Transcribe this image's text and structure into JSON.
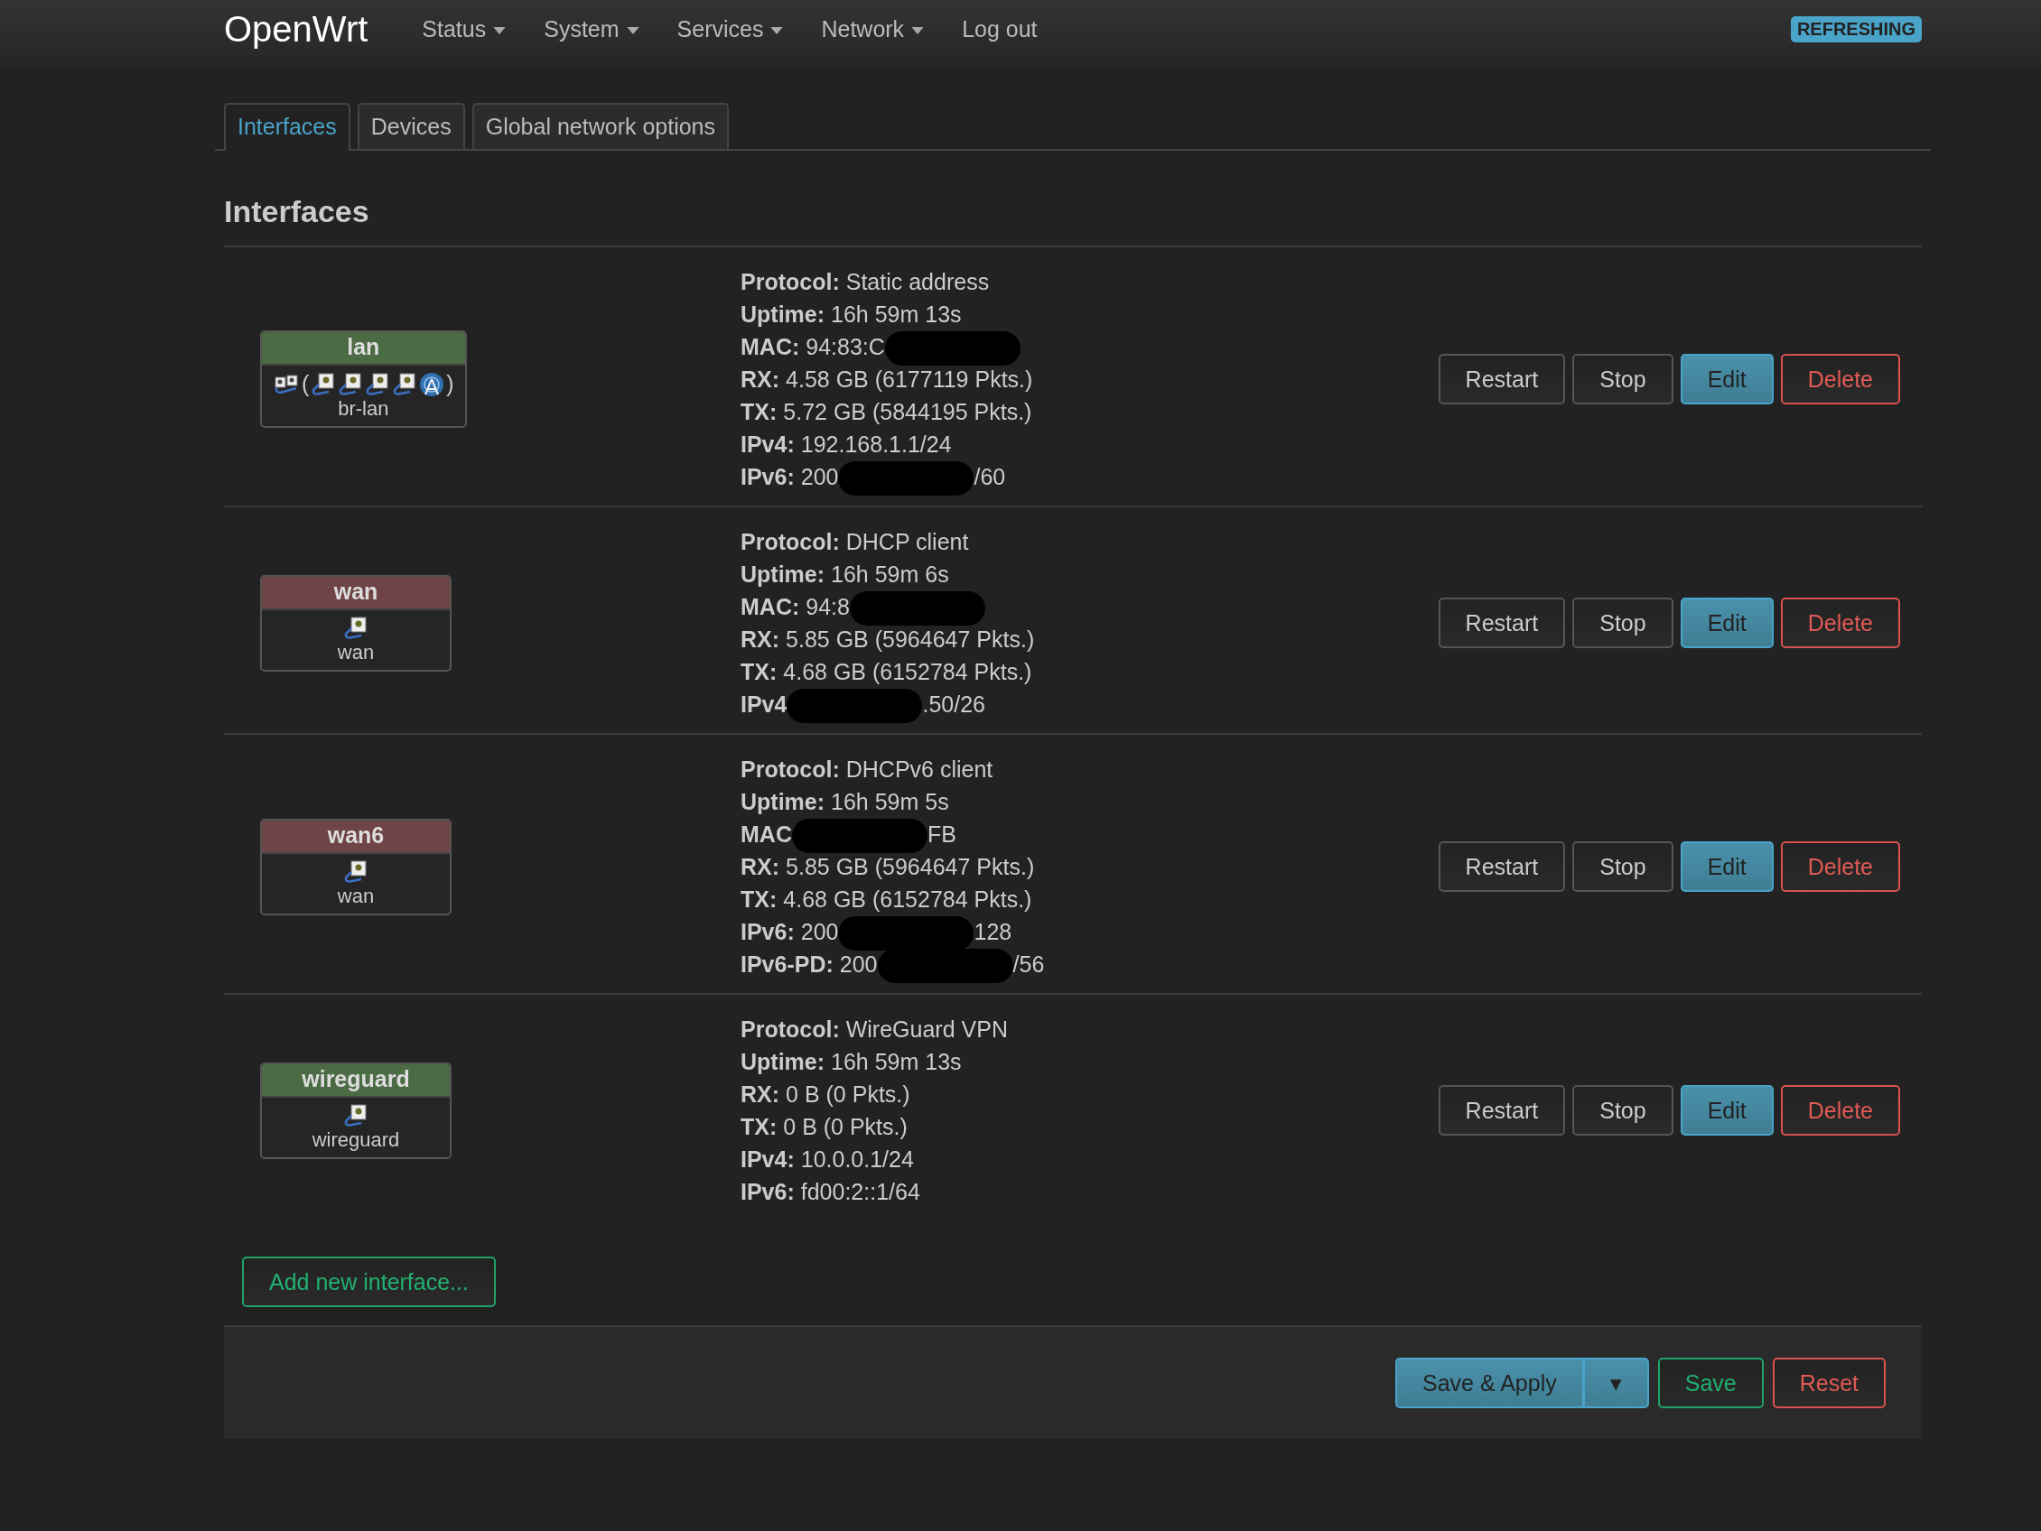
{
  "brand": "OpenWrt",
  "nav": [
    {
      "label": "Status",
      "dropdown": true
    },
    {
      "label": "System",
      "dropdown": true
    },
    {
      "label": "Services",
      "dropdown": true
    },
    {
      "label": "Network",
      "dropdown": true
    },
    {
      "label": "Log out",
      "dropdown": false
    }
  ],
  "indicator": "REFRESHING",
  "tabs": [
    {
      "label": "Interfaces",
      "selected": true
    },
    {
      "label": "Devices",
      "selected": false
    },
    {
      "label": "Global network options",
      "selected": false
    }
  ],
  "heading": "Interfaces",
  "interfaces": [
    {
      "name": "lan",
      "color": "#4a6b44",
      "device": "br-lan",
      "icons": [
        {
          "kind": "bridge"
        },
        {
          "kind": "text",
          "text": "("
        },
        {
          "kind": "ethernet"
        },
        {
          "kind": "ethernet"
        },
        {
          "kind": "ethernet"
        },
        {
          "kind": "ethernet"
        },
        {
          "kind": "wireless"
        },
        {
          "kind": "text",
          "text": ")"
        }
      ],
      "details": [
        {
          "label": "Protocol:",
          "value": "Static address"
        },
        {
          "label": "Uptime:",
          "value": "16h 59m 13s"
        },
        {
          "label": "MAC:",
          "value": "94:83:C",
          "redacted": true
        },
        {
          "label": "RX:",
          "value": "4.58 GB (6177119 Pkts.)"
        },
        {
          "label": "TX:",
          "value": "5.72 GB (5844195 Pkts.)"
        },
        {
          "label": "IPv4:",
          "value": "192.168.1.1/24"
        },
        {
          "label": "IPv6:",
          "value": "200",
          "redacted": true,
          "tail": "/60"
        }
      ],
      "actions": [
        {
          "label": "Restart",
          "kind": "neutral"
        },
        {
          "label": "Stop",
          "kind": "neutral"
        },
        {
          "label": "Edit",
          "kind": "primary"
        },
        {
          "label": "Delete",
          "kind": "danger"
        }
      ]
    },
    {
      "name": "wan",
      "color": "#6e4446",
      "device": "wan",
      "icons": [
        {
          "kind": "ethernet"
        }
      ],
      "details": [
        {
          "label": "Protocol:",
          "value": "DHCP client"
        },
        {
          "label": "Uptime:",
          "value": "16h 59m 6s"
        },
        {
          "label": "MAC:",
          "value": "94:8",
          "redacted": true
        },
        {
          "label": "RX:",
          "value": "5.85 GB (5964647 Pkts.)"
        },
        {
          "label": "TX:",
          "value": "4.68 GB (6152784 Pkts.)"
        },
        {
          "label": "IPv4",
          "redacted": true,
          "tail": ".50/26"
        }
      ],
      "actions": [
        {
          "label": "Restart",
          "kind": "neutral"
        },
        {
          "label": "Stop",
          "kind": "neutral"
        },
        {
          "label": "Edit",
          "kind": "primary"
        },
        {
          "label": "Delete",
          "kind": "danger"
        }
      ]
    },
    {
      "name": "wan6",
      "color": "#6e4446",
      "device": "wan",
      "icons": [
        {
          "kind": "ethernet"
        }
      ],
      "details": [
        {
          "label": "Protocol:",
          "value": "DHCPv6 client"
        },
        {
          "label": "Uptime:",
          "value": "16h 59m 5s"
        },
        {
          "label": "MAC",
          "redacted": true,
          "tail": "FB"
        },
        {
          "label": "RX:",
          "value": "5.85 GB (5964647 Pkts.)"
        },
        {
          "label": "TX:",
          "value": "4.68 GB (6152784 Pkts.)"
        },
        {
          "label": "IPv6:",
          "value": "200",
          "redacted": true,
          "tail": "128"
        },
        {
          "label": "IPv6-PD:",
          "value": "200",
          "redacted": true,
          "tail": "/56"
        }
      ],
      "actions": [
        {
          "label": "Restart",
          "kind": "neutral"
        },
        {
          "label": "Stop",
          "kind": "neutral"
        },
        {
          "label": "Edit",
          "kind": "primary"
        },
        {
          "label": "Delete",
          "kind": "danger"
        }
      ]
    },
    {
      "name": "wireguard",
      "color": "#4a6b44",
      "device": "wireguard",
      "icons": [
        {
          "kind": "ethernet"
        }
      ],
      "details": [
        {
          "label": "Protocol:",
          "value": "WireGuard VPN"
        },
        {
          "label": "Uptime:",
          "value": "16h 59m 13s"
        },
        {
          "label": "RX:",
          "value": "0 B (0 Pkts.)"
        },
        {
          "label": "TX:",
          "value": "0 B (0 Pkts.)"
        },
        {
          "label": "IPv4:",
          "value": "10.0.0.1/24"
        },
        {
          "label": "IPv6:",
          "value": "fd00:2::1/64"
        }
      ],
      "actions": [
        {
          "label": "Restart",
          "kind": "neutral"
        },
        {
          "label": "Stop",
          "kind": "neutral"
        },
        {
          "label": "Edit",
          "kind": "primary"
        },
        {
          "label": "Delete",
          "kind": "danger"
        }
      ]
    }
  ],
  "add_button": "Add new interface...",
  "footer": {
    "apply": "Save & Apply",
    "apply_menu": "▾",
    "buttons": [
      {
        "label": "Save",
        "kind": "positive"
      },
      {
        "label": "Reset",
        "kind": "danger"
      }
    ]
  }
}
